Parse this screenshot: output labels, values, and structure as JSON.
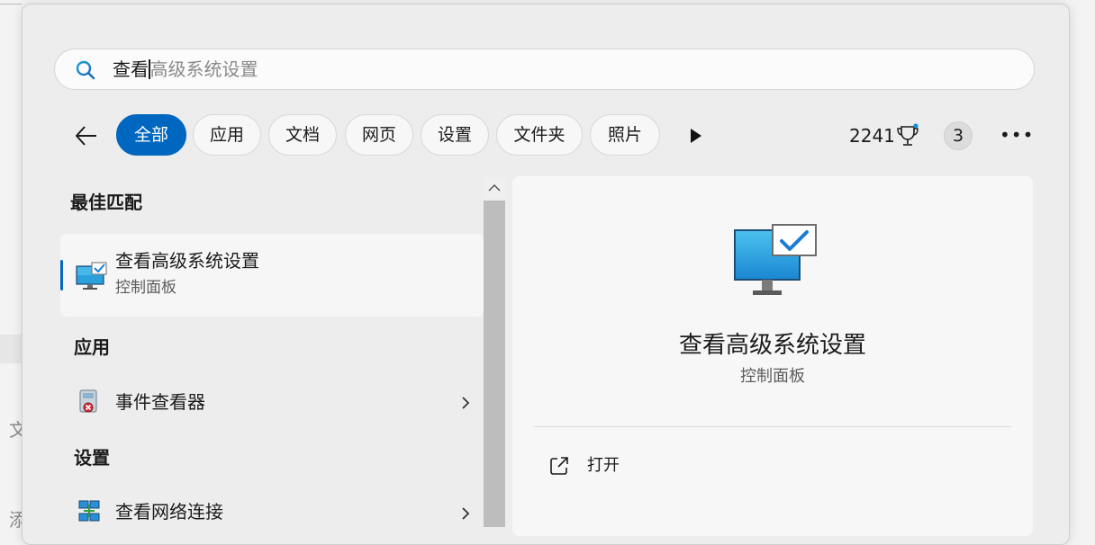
{
  "search": {
    "typed": "查看",
    "suggestion": "高级系统设置"
  },
  "filters": [
    "全部",
    "应用",
    "文档",
    "网页",
    "设置",
    "文件夹",
    "照片"
  ],
  "rewards": {
    "points": "2241",
    "badge_count": "3"
  },
  "results": {
    "best_match_header": "最佳匹配",
    "best_match": {
      "title": "查看高级系统设置",
      "subtitle": "控制面板"
    },
    "apps_header": "应用",
    "apps": [
      {
        "title": "事件查看器"
      }
    ],
    "settings_header": "设置",
    "settings": [
      {
        "title": "查看网络连接"
      }
    ]
  },
  "preview": {
    "title": "查看高级系统设置",
    "subtitle": "控制面板",
    "actions": [
      {
        "label": "打开",
        "icon": "open-external-icon"
      }
    ]
  },
  "background": {
    "text_a": "文",
    "text_b": "添"
  },
  "colors": {
    "accent": "#0067c0",
    "panel_bg": "#ededed"
  }
}
